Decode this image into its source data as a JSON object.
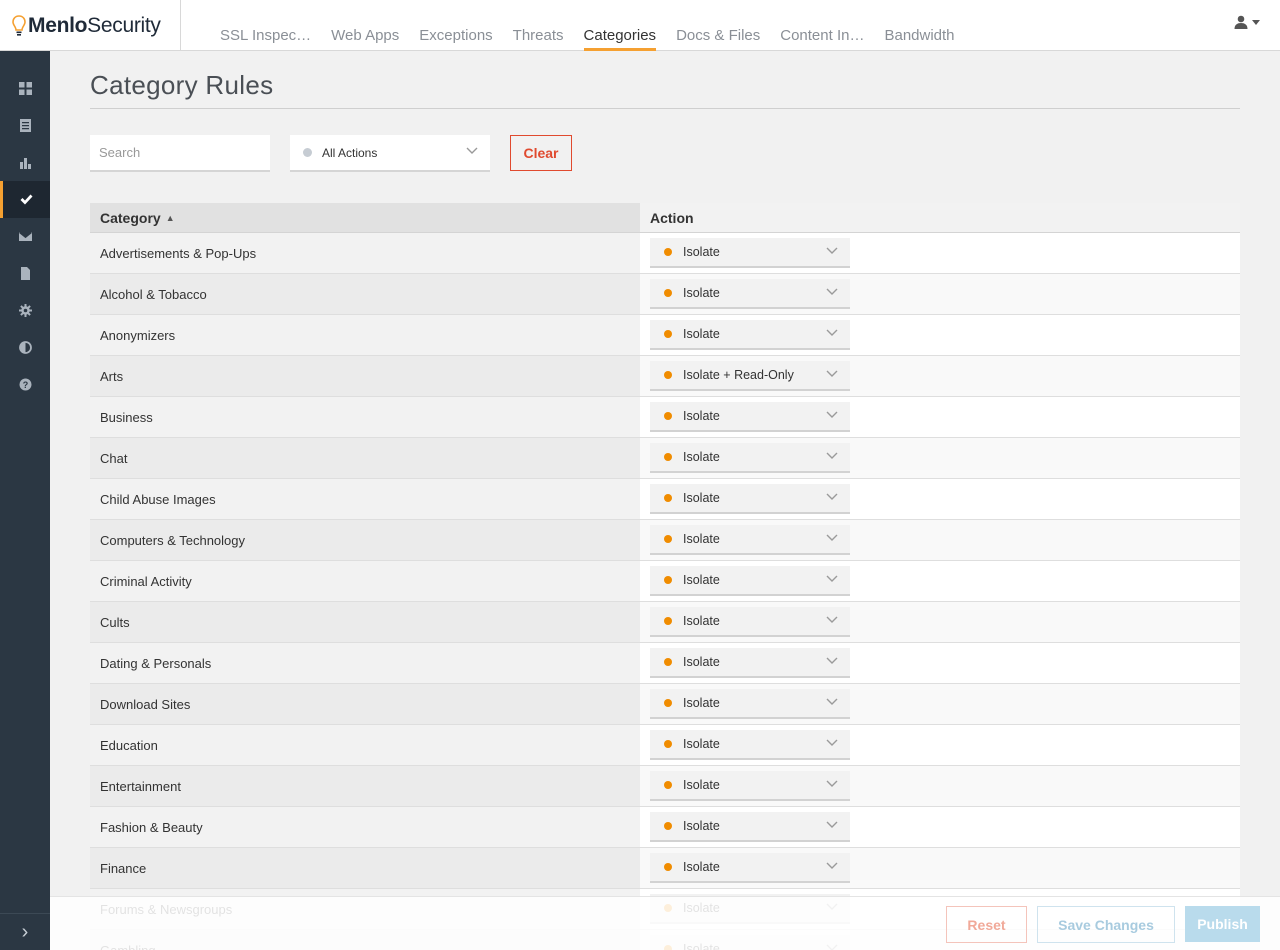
{
  "brand": {
    "name_bold": "Menlo",
    "name_rest": "Security",
    "accent": "#f5a031"
  },
  "nav": {
    "tabs": [
      {
        "label": "SSL Inspec…",
        "active": false
      },
      {
        "label": "Web Apps",
        "active": false
      },
      {
        "label": "Exceptions",
        "active": false
      },
      {
        "label": "Threats",
        "active": false
      },
      {
        "label": "Categories",
        "active": true
      },
      {
        "label": "Docs & Files",
        "active": false
      },
      {
        "label": "Content In…",
        "active": false
      },
      {
        "label": "Bandwidth",
        "active": false
      }
    ]
  },
  "sidebar": {
    "items": [
      {
        "icon": "dashboard-grid-icon",
        "active": false
      },
      {
        "icon": "logs-list-icon",
        "active": false
      },
      {
        "icon": "reports-chart-icon",
        "active": false
      },
      {
        "icon": "policy-check-icon",
        "active": true
      },
      {
        "icon": "mail-icon",
        "active": false
      },
      {
        "icon": "document-icon",
        "active": false
      },
      {
        "icon": "settings-gear-icon",
        "active": false
      },
      {
        "icon": "contrast-icon",
        "active": false
      },
      {
        "icon": "help-icon",
        "active": false
      }
    ],
    "toggle_glyph": "›"
  },
  "page": {
    "title": "Category Rules"
  },
  "filters": {
    "search_placeholder": "Search",
    "action_filter": "All Actions",
    "clear_label": "Clear"
  },
  "table": {
    "headers": {
      "category": "Category",
      "action": "Action"
    },
    "sort_glyph": "▲",
    "rows": [
      {
        "category": "Advertisements & Pop-Ups",
        "action": "Isolate"
      },
      {
        "category": "Alcohol & Tobacco",
        "action": "Isolate"
      },
      {
        "category": "Anonymizers",
        "action": "Isolate"
      },
      {
        "category": "Arts",
        "action": "Isolate + Read-Only"
      },
      {
        "category": "Business",
        "action": "Isolate"
      },
      {
        "category": "Chat",
        "action": "Isolate"
      },
      {
        "category": "Child Abuse Images",
        "action": "Isolate"
      },
      {
        "category": "Computers & Technology",
        "action": "Isolate"
      },
      {
        "category": "Criminal Activity",
        "action": "Isolate"
      },
      {
        "category": "Cults",
        "action": "Isolate"
      },
      {
        "category": "Dating & Personals",
        "action": "Isolate"
      },
      {
        "category": "Download Sites",
        "action": "Isolate"
      },
      {
        "category": "Education",
        "action": "Isolate"
      },
      {
        "category": "Entertainment",
        "action": "Isolate"
      },
      {
        "category": "Fashion & Beauty",
        "action": "Isolate"
      },
      {
        "category": "Finance",
        "action": "Isolate"
      },
      {
        "category": "Forums & Newsgroups",
        "action": "Isolate"
      },
      {
        "category": "Gambling",
        "action": "Isolate"
      }
    ]
  },
  "footer": {
    "reset_label": "Reset",
    "save_label": "Save Changes",
    "publish_label": "Publish"
  },
  "colors": {
    "action_dot": "#f08c00",
    "danger": "#e04a2f",
    "sidebar_bg": "#2b3743"
  }
}
